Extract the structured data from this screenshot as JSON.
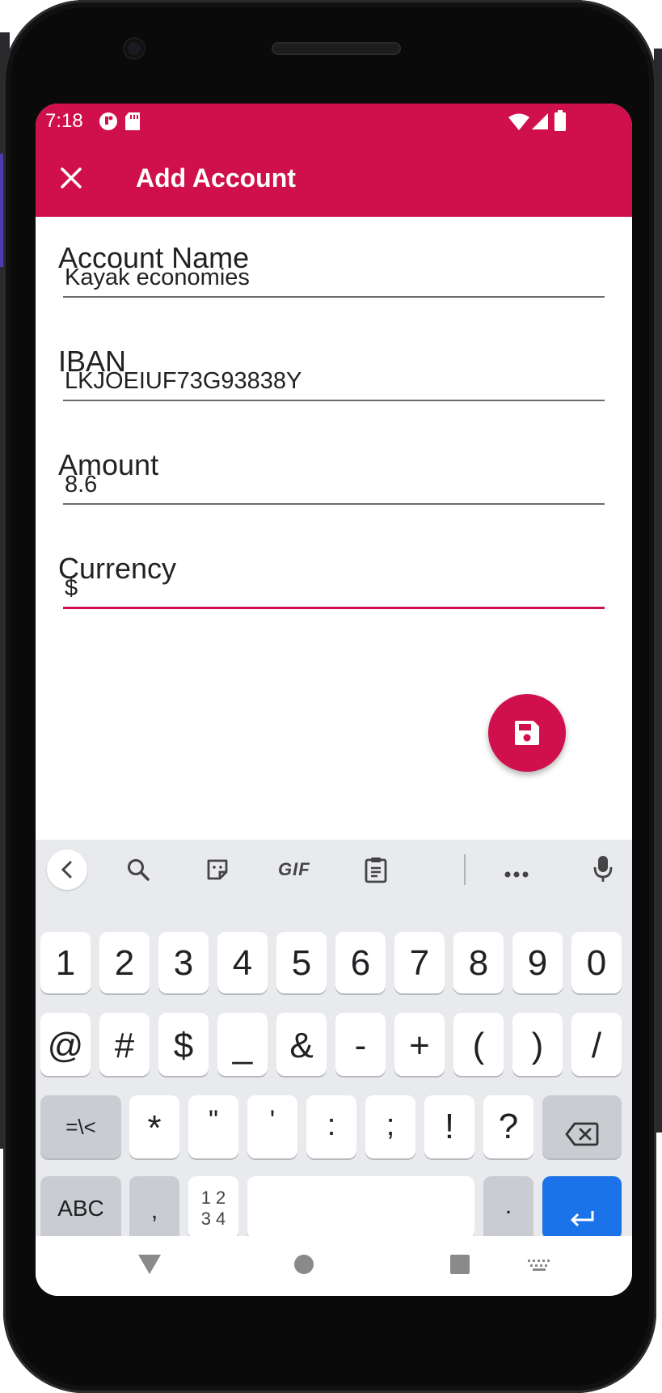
{
  "status_bar": {
    "time": "7:18"
  },
  "app_bar": {
    "title": "Add Account"
  },
  "form": {
    "account_name": {
      "label": "Account Name",
      "value": "Kayak economies"
    },
    "iban": {
      "label": "IBAN",
      "value": "LKJOEIUF73G93838Y"
    },
    "amount": {
      "label": "Amount",
      "value": "8.6"
    },
    "currency": {
      "label": "Currency",
      "value": "$"
    }
  },
  "keyboard": {
    "toolbar": {
      "gif_label": "GIF"
    },
    "row1": [
      "1",
      "2",
      "3",
      "4",
      "5",
      "6",
      "7",
      "8",
      "9",
      "0"
    ],
    "row2": [
      "@",
      "#",
      "$",
      "_",
      "&",
      "-",
      "+",
      "(",
      ")",
      "/"
    ],
    "row3": [
      "=\\<",
      "*",
      "\"",
      "'",
      ":",
      ";",
      "!",
      "?"
    ],
    "row4": {
      "abc": "ABC",
      "comma": ",",
      "numpad_top": "1 2",
      "numpad_bottom": "3 4",
      "period": "."
    }
  },
  "colors": {
    "accent": "#d0104c",
    "enter_key": "#1a73e8",
    "keyboard_bg": "#e8eaed"
  },
  "icons": {
    "close": "close-icon",
    "save": "save-icon",
    "back": "chevron-left-icon",
    "search": "search-icon",
    "sticker": "sticker-icon",
    "clipboard": "clipboard-icon",
    "more": "more-icon",
    "mic": "mic-icon",
    "backspace": "backspace-icon",
    "enter": "enter-icon"
  }
}
